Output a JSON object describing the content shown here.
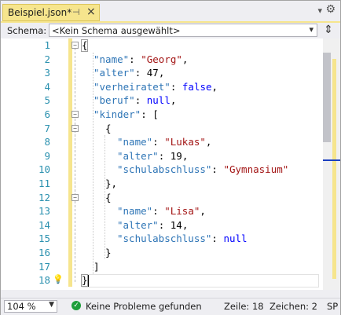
{
  "tab": {
    "title": "Beispiel.json*",
    "pin_icon": "pin-icon",
    "close_icon": "close-icon"
  },
  "schema": {
    "label": "Schema:",
    "value": "<Kein Schema ausgewählt>"
  },
  "lines": [
    {
      "n": "1"
    },
    {
      "n": "2"
    },
    {
      "n": "3"
    },
    {
      "n": "4"
    },
    {
      "n": "5"
    },
    {
      "n": "6"
    },
    {
      "n": "7"
    },
    {
      "n": "8"
    },
    {
      "n": "9"
    },
    {
      "n": "10"
    },
    {
      "n": "11"
    },
    {
      "n": "12"
    },
    {
      "n": "13"
    },
    {
      "n": "14"
    },
    {
      "n": "15"
    },
    {
      "n": "16"
    },
    {
      "n": "17"
    },
    {
      "n": "18"
    }
  ],
  "code": {
    "l1": {
      "a": "{"
    },
    "l2": {
      "k": "\"name\"",
      "c": ": ",
      "v": "\"Georg\"",
      "e": ","
    },
    "l3": {
      "k": "\"alter\"",
      "c": ": ",
      "v": "47",
      "e": ","
    },
    "l4": {
      "k": "\"verheiratet\"",
      "c": ": ",
      "v": "false",
      "e": ","
    },
    "l5": {
      "k": "\"beruf\"",
      "c": ": ",
      "v": "null",
      "e": ","
    },
    "l6": {
      "k": "\"kinder\"",
      "c": ": ",
      "v": "["
    },
    "l7": {
      "a": "{"
    },
    "l8": {
      "k": "\"name\"",
      "c": ": ",
      "v": "\"Lukas\"",
      "e": ","
    },
    "l9": {
      "k": "\"alter\"",
      "c": ": ",
      "v": "19",
      "e": ","
    },
    "l10": {
      "k": "\"schulabschluss\"",
      "c": ": ",
      "v": "\"Gymnasium\""
    },
    "l11": {
      "a": "},"
    },
    "l12": {
      "a": "{"
    },
    "l13": {
      "k": "\"name\"",
      "c": ": ",
      "v": "\"Lisa\"",
      "e": ","
    },
    "l14": {
      "k": "\"alter\"",
      "c": ": ",
      "v": "14",
      "e": ","
    },
    "l15": {
      "k": "\"schulabschluss\"",
      "c": ": ",
      "v": "null"
    },
    "l16": {
      "a": "}"
    },
    "l17": {
      "a": "]"
    },
    "l18": {
      "a": "}"
    }
  },
  "status": {
    "zoom": "104 %",
    "problems": "Keine Probleme gefunden",
    "line": "Zeile: 18",
    "column": "Zeichen: 2",
    "mode": "SP"
  },
  "colors": {
    "accent": "#f6e58d",
    "key": "#2e75b6",
    "string": "#a31515",
    "keyword": "#0000ff",
    "linenum": "#2b91af"
  }
}
